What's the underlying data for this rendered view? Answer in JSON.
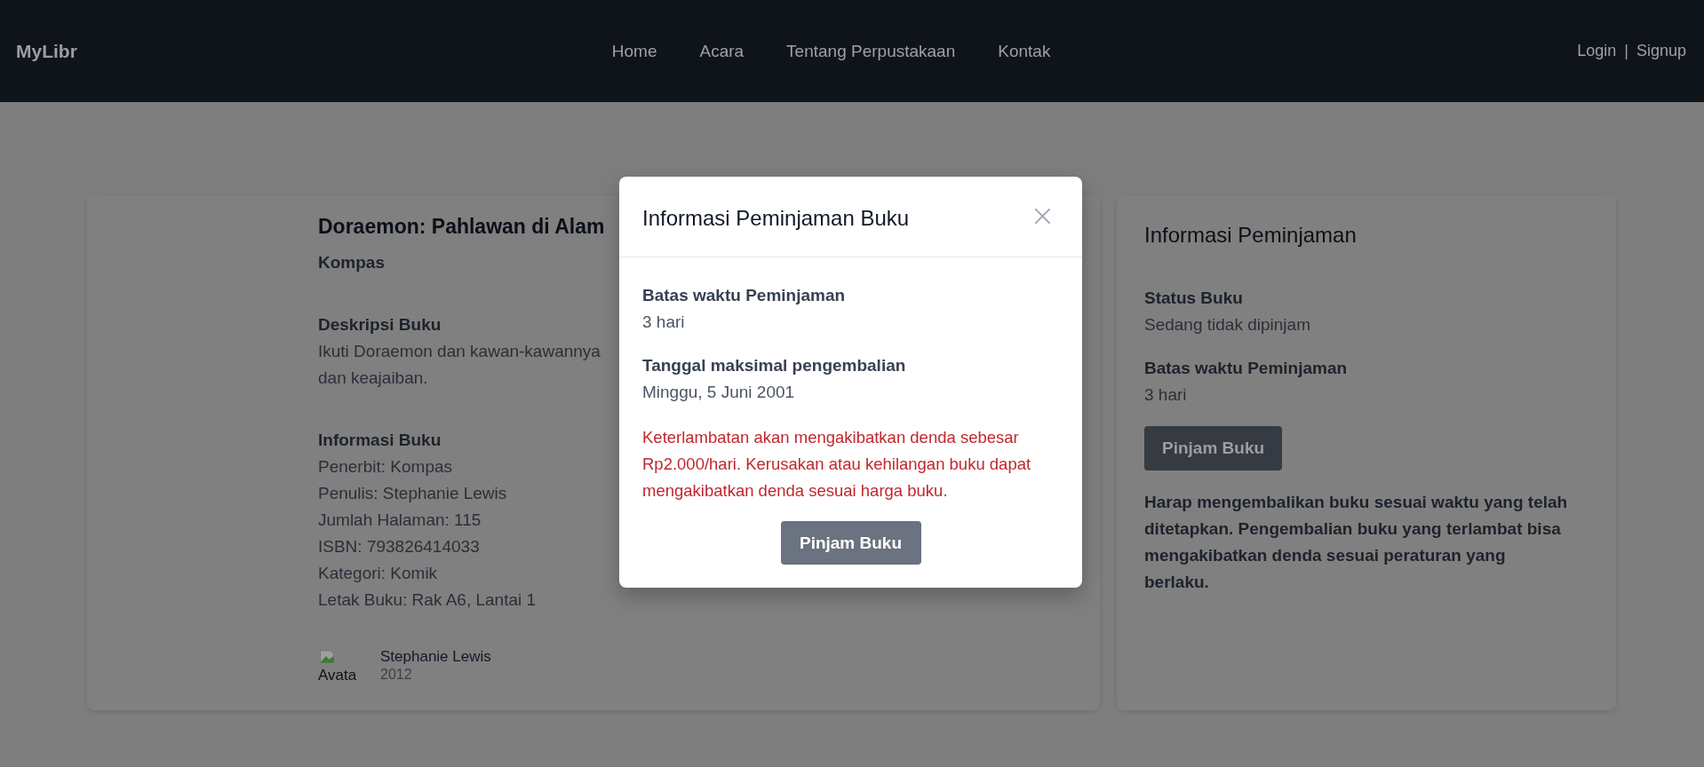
{
  "navbar": {
    "logo": "MyLibr",
    "links": [
      "Home",
      "Acara",
      "Tentang Perpustakaan",
      "Kontak"
    ],
    "auth": {
      "login": "Login",
      "separator": "|",
      "signup": "Signup"
    }
  },
  "book": {
    "title": "Doraemon: Pahlawan di Alam",
    "publisher": "Kompas",
    "description": {
      "heading": "Deskripsi Buku",
      "lines": [
        "Ikuti Doraemon dan kawan-kawannya",
        "dan keajaiban."
      ]
    },
    "info": {
      "heading": "Informasi Buku",
      "lines": [
        "Penerbit: Kompas",
        "Penulis: Stephanie Lewis",
        "Jumlah Halaman: 115",
        "ISBN: 793826414033",
        "Kategori: Komik",
        "Letak Buku: Rak A6, Lantai 1"
      ]
    },
    "author": {
      "avatar_alt": "Avata",
      "name": "Stephanie Lewis",
      "year": "2012"
    }
  },
  "loan_panel": {
    "title": "Informasi Peminjaman",
    "fields": [
      {
        "label": "Status Buku",
        "value": "Sedang tidak dipinjam"
      },
      {
        "label": "Batas waktu Peminjaman",
        "value": "3 hari"
      }
    ],
    "button": "Pinjam Buku",
    "notice": "Harap mengembalikan buku sesuai waktu yang telah ditetapkan. Pengembalian buku yang terlambat bisa mengakibatkan denda sesuai peraturan yang berlaku."
  },
  "modal": {
    "title": "Informasi Peminjaman Buku",
    "fields": [
      {
        "label": "Batas waktu Peminjaman",
        "value": "3 hari"
      },
      {
        "label": "Tanggal maksimal pengembalian",
        "value": "Minggu, 5 Juni 2001"
      }
    ],
    "warning": "Keterlambatan akan mengakibatkan denda sebesar Rp2.000/hari. Kerusakan atau kehilangan buku dapat mengakibatkan denda sesuai harga buku.",
    "button": "Pinjam Buku"
  }
}
